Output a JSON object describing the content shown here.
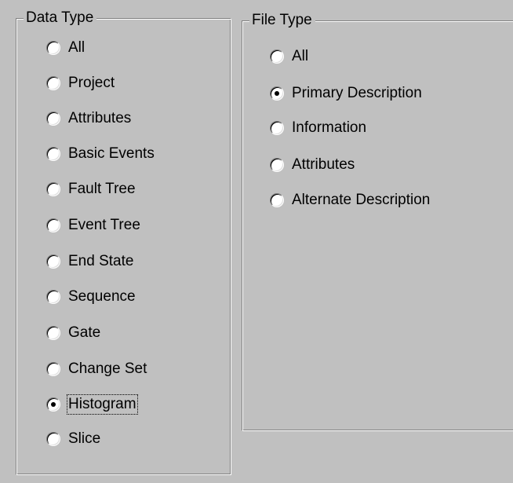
{
  "data_type": {
    "title": "Data Type",
    "options": [
      {
        "label": "All",
        "checked": false
      },
      {
        "label": "Project",
        "checked": false
      },
      {
        "label": "Attributes",
        "checked": false
      },
      {
        "label": "Basic Events",
        "checked": false
      },
      {
        "label": "Fault Tree",
        "checked": false
      },
      {
        "label": "Event Tree",
        "checked": false
      },
      {
        "label": "End State",
        "checked": false
      },
      {
        "label": "Sequence",
        "checked": false
      },
      {
        "label": "Gate",
        "checked": false
      },
      {
        "label": "Change Set",
        "checked": false
      },
      {
        "label": "Histogram",
        "checked": true,
        "focused": true
      },
      {
        "label": "Slice",
        "checked": false
      }
    ]
  },
  "file_type": {
    "title": "File Type",
    "options": [
      {
        "label": "All",
        "checked": false
      },
      {
        "label": "Primary Description",
        "checked": true
      },
      {
        "label": "Information",
        "checked": false
      },
      {
        "label": "Attributes",
        "checked": false
      },
      {
        "label": "Alternate Description",
        "checked": false
      }
    ]
  }
}
